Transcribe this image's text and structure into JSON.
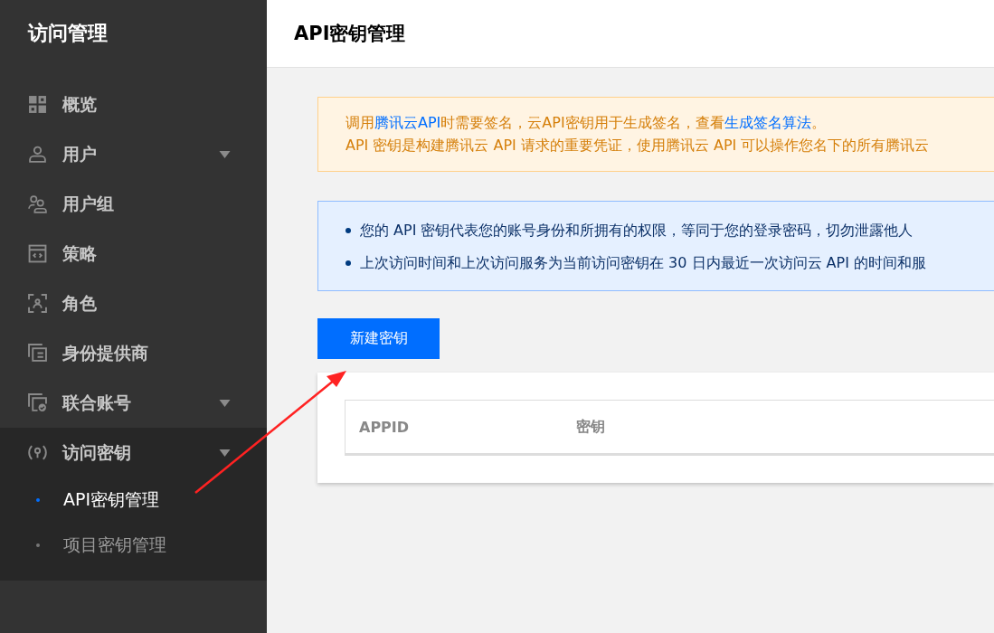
{
  "sidebar": {
    "title": "访问管理",
    "items": [
      {
        "label": "概览",
        "expandable": false,
        "expanded": false
      },
      {
        "label": "用户",
        "expandable": true,
        "expanded": false
      },
      {
        "label": "用户组",
        "expandable": false,
        "expanded": false
      },
      {
        "label": "策略",
        "expandable": false,
        "expanded": false
      },
      {
        "label": "角色",
        "expandable": false,
        "expanded": false
      },
      {
        "label": "身份提供商",
        "expandable": false,
        "expanded": false
      },
      {
        "label": "联合账号",
        "expandable": true,
        "expanded": false
      },
      {
        "label": "访问密钥",
        "expandable": true,
        "expanded": true,
        "children": [
          {
            "label": "API密钥管理",
            "selected": true
          },
          {
            "label": "项目密钥管理",
            "selected": false
          }
        ]
      }
    ]
  },
  "header": {
    "title": "API密钥管理"
  },
  "notice": {
    "lines": [
      [
        {
          "kind": "text",
          "text": "调用"
        },
        {
          "kind": "link",
          "text": "腾讯云API"
        },
        {
          "kind": "text",
          "text": "时需要签名，云API密钥用于生成签名，查看"
        },
        {
          "kind": "link",
          "text": "生成签名算法"
        },
        {
          "kind": "text",
          "text": "。"
        }
      ],
      [
        {
          "kind": "text",
          "text": "API 密钥是构建腾讯云 API 请求的重要凭证，使用腾讯云 API 可以操作您名下的所有腾讯云"
        }
      ]
    ]
  },
  "info": {
    "bullets": [
      "您的 API 密钥代表您的账号身份和所拥有的权限，等同于您的登录密码，切勿泄露他人",
      "上次访问时间和上次访问服务为当前访问密钥在 30 日内最近一次访问云 API 的时间和服"
    ]
  },
  "create_button": "新建密钥",
  "table": {
    "columns": [
      "APPID",
      "密钥"
    ]
  }
}
